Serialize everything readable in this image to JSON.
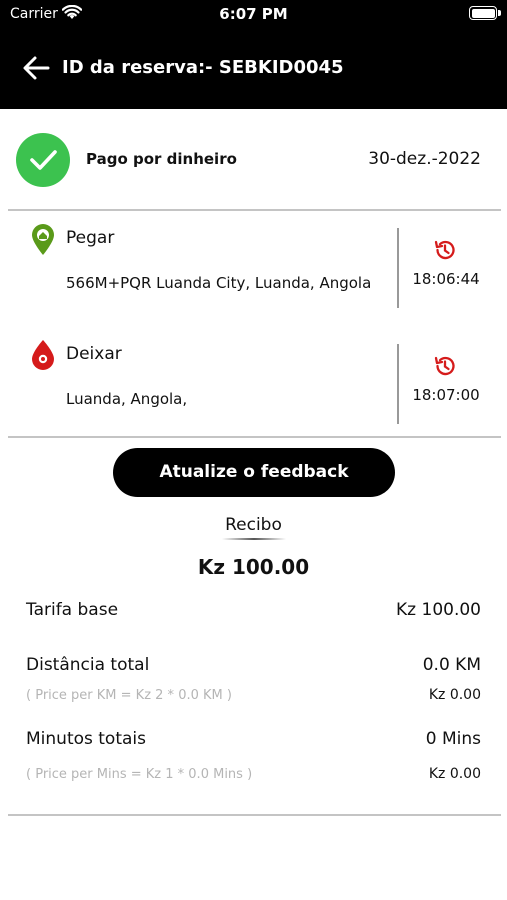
{
  "status_bar": {
    "carrier": "Carrier",
    "time": "6:07 PM"
  },
  "header": {
    "title": "ID da reserva:- SEBKID0045"
  },
  "payment": {
    "method": "Pago por dinheiro",
    "date": "30-dez.-2022"
  },
  "pickup": {
    "label": "Pegar",
    "address": "566M+PQR Luanda City, Luanda, Angola",
    "time": "18:06:44"
  },
  "dropoff": {
    "label": "Deixar",
    "address": "Luanda, Angola,",
    "time": "18:07:00"
  },
  "feedback_button": "Atualize o feedback",
  "receipt": {
    "title": "Recibo",
    "total": "Kz 100.00",
    "base_fare": {
      "label": "Tarifa base",
      "value": "Kz 100.00"
    },
    "distance": {
      "label": "Distância total",
      "value": "0.0 KM",
      "detail": "( Price per KM = Kz 2 * 0.0 KM )",
      "detail_value": "Kz 0.00"
    },
    "minutes": {
      "label": "Minutos totais",
      "value": "0 Mins",
      "detail": "( Price per Mins = Kz 1 * 0.0 Mins )",
      "detail_value": "Kz 0.00"
    }
  },
  "colors": {
    "header_bg": "#000000",
    "success": "#3cc24f",
    "pickup_pin": "#5a9a1a",
    "dropoff_pin": "#d51b1b",
    "history_icon": "#d51b1b"
  }
}
